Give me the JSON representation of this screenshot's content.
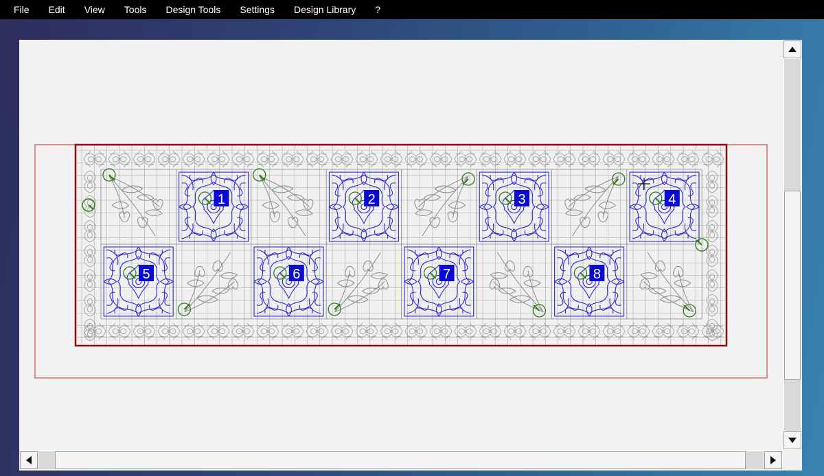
{
  "menu": {
    "items": [
      {
        "key": "file",
        "label": "File"
      },
      {
        "key": "edit",
        "label": "Edit"
      },
      {
        "key": "view",
        "label": "View"
      },
      {
        "key": "tools",
        "label": "Tools"
      },
      {
        "key": "design-tools",
        "label": "Design Tools"
      },
      {
        "key": "settings",
        "label": "Settings"
      },
      {
        "key": "design-library",
        "label": "Design Library"
      },
      {
        "key": "help",
        "label": "?"
      }
    ]
  },
  "canvas": {
    "colors": {
      "background": "#f2f2f2",
      "outer_boundary": "#d42a2a",
      "quilt_border": "#8b0e0e",
      "grid": "#a8a8a8",
      "selected_block_stitch": "#2a2ad8",
      "unselected_block_stitch": "#8a8a8a",
      "start_end_marker": "#2e7d16",
      "label_background": "#0a0ad0",
      "label_text": "#ffffff"
    },
    "block_labels": [
      "1",
      "2",
      "3",
      "4",
      "5",
      "6",
      "7",
      "8"
    ]
  },
  "icons": {
    "scroll_up": "scroll-up-arrow-icon",
    "scroll_down": "scroll-down-arrow-icon",
    "scroll_left": "scroll-left-arrow-icon",
    "scroll_right": "scroll-right-arrow-icon",
    "block_marker": "start-point-circle-icon",
    "cursor": "crosshair-cursor-icon"
  }
}
